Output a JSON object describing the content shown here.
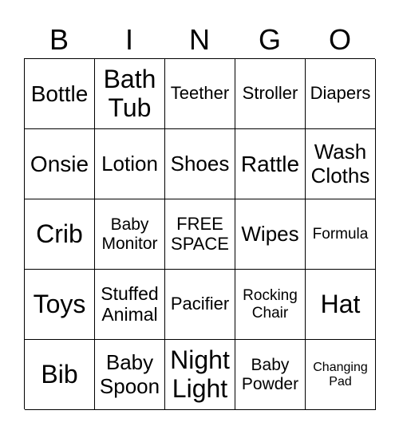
{
  "header": [
    "B",
    "I",
    "N",
    "G",
    "O"
  ],
  "cells": [
    {
      "t": "Bottle",
      "s": 28
    },
    {
      "t": "Bath\nTub",
      "s": 32
    },
    {
      "t": "Teether",
      "s": 22
    },
    {
      "t": "Stroller",
      "s": 22
    },
    {
      "t": "Diapers",
      "s": 22
    },
    {
      "t": "Onsie",
      "s": 28
    },
    {
      "t": "Lotion",
      "s": 26
    },
    {
      "t": "Shoes",
      "s": 26
    },
    {
      "t": "Rattle",
      "s": 28
    },
    {
      "t": "Wash\nCloths",
      "s": 26
    },
    {
      "t": "Crib",
      "s": 32
    },
    {
      "t": "Baby\nMonitor",
      "s": 21
    },
    {
      "t": "FREE\nSPACE",
      "s": 22
    },
    {
      "t": "Wipes",
      "s": 26
    },
    {
      "t": "Formula",
      "s": 19
    },
    {
      "t": "Toys",
      "s": 32
    },
    {
      "t": "Stuffed\nAnimal",
      "s": 23
    },
    {
      "t": "Pacifier",
      "s": 22
    },
    {
      "t": "Rocking\nChair",
      "s": 19
    },
    {
      "t": "Hat",
      "s": 32
    },
    {
      "t": "Bib",
      "s": 32
    },
    {
      "t": "Baby\nSpoon",
      "s": 26
    },
    {
      "t": "Night\nLight",
      "s": 32
    },
    {
      "t": "Baby\nPowder",
      "s": 21
    },
    {
      "t": "Changing\nPad",
      "s": 16
    }
  ]
}
